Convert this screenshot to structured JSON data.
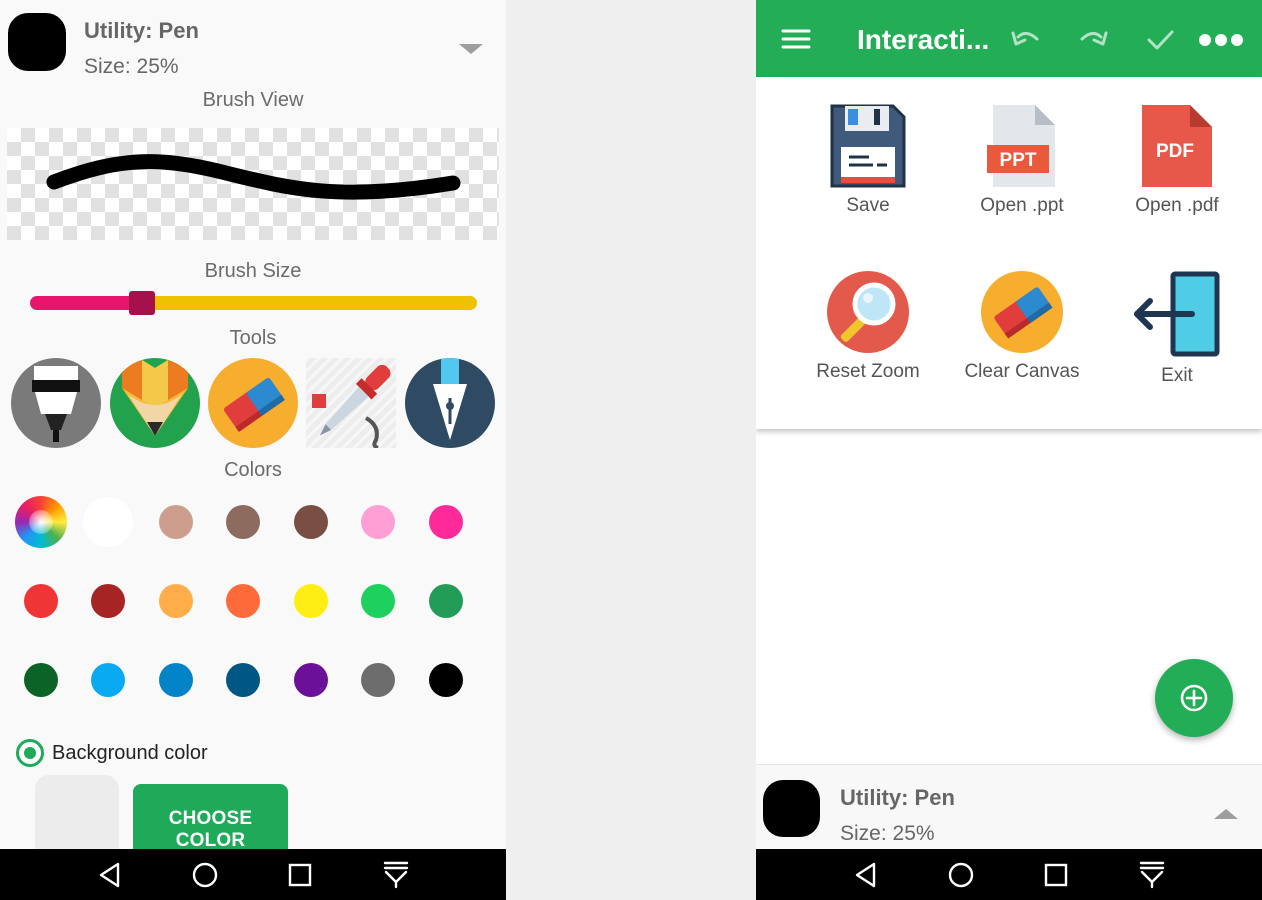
{
  "left_panel": {
    "utility": {
      "title": "Utility: Pen",
      "size": "Size: 25%",
      "color": "#000000",
      "expand_icon": "caret-down-icon"
    },
    "brush_view_label": "Brush View",
    "brush_size_label": "Brush Size",
    "brush_size_fraction": 0.25,
    "slider_colors": {
      "active": "#e8146d",
      "inactive": "#eec200",
      "thumb": "#a5114b"
    },
    "tools_label": "Tools",
    "tools": [
      {
        "name": "marker",
        "icon": "marker-icon",
        "bg": "#7a7a7a"
      },
      {
        "name": "pencil",
        "icon": "pencil-icon",
        "bg": "#23a24d"
      },
      {
        "name": "eraser",
        "icon": "eraser-icon",
        "bg": "#f7ae2e"
      },
      {
        "name": "dropper",
        "icon": "eyedropper-icon",
        "bg": "#e6e6e6"
      },
      {
        "name": "fountain-pen",
        "icon": "fountain-pen-icon",
        "bg": "#2e4b63"
      }
    ],
    "colors_label": "Colors",
    "colors": [
      [
        "wheel",
        "#ffffff",
        "#cd9e8d",
        "#8e6b5f",
        "#7a4f43",
        "#ff9fd6",
        "#ff2a9a"
      ],
      [
        "#ef3535",
        "#a72424",
        "#ffad48",
        "#ff6a3a",
        "#ffee13",
        "#1ed15f",
        "#229c56"
      ],
      [
        "#0c6328",
        "#0aaaf3",
        "#0384c8",
        "#005783",
        "#6a1099",
        "#6d6d6d",
        "#000000"
      ]
    ],
    "background": {
      "label": "Background color",
      "selected": true,
      "preview_color": "#ececec",
      "button_label": "CHOOSE COLOR"
    }
  },
  "right_panel": {
    "app_title": "Interacti...",
    "appbar_icons": [
      "menu-icon",
      "undo-icon",
      "redo-icon",
      "check-icon",
      "more-icon"
    ],
    "menu_items": [
      {
        "label": "Save",
        "icon": "save-icon"
      },
      {
        "label": "Open .ppt",
        "icon": "ppt-file-icon",
        "badge": "PPT"
      },
      {
        "label": "Open .pdf",
        "icon": "pdf-file-icon",
        "badge": "PDF"
      },
      {
        "label": "Reset Zoom",
        "icon": "magnifier-icon"
      },
      {
        "label": "Clear Canvas",
        "icon": "eraser-icon"
      },
      {
        "label": "Exit",
        "icon": "exit-icon"
      }
    ],
    "fab_icon": "add-circle-icon",
    "utility": {
      "title": "Utility: Pen",
      "size": "Size: 25%",
      "color": "#000000",
      "expand_icon": "caret-up-icon"
    }
  },
  "navbar": {
    "icons": [
      "back-icon",
      "home-icon",
      "recents-icon",
      "notifications-icon"
    ]
  },
  "theme": {
    "primary": "#23ad57"
  }
}
